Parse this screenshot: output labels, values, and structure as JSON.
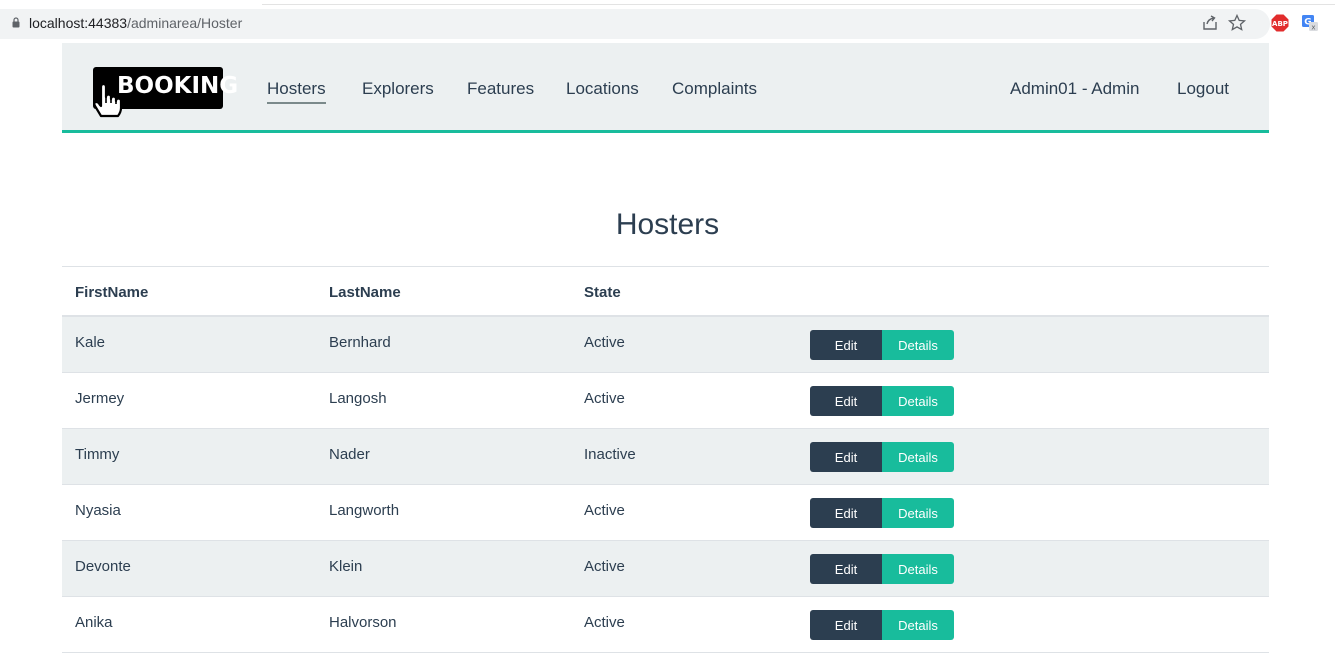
{
  "browser": {
    "url_host": "localhost:44383",
    "url_path": "/adminarea/Hoster",
    "icons": [
      "lock-icon",
      "share-icon",
      "star-icon",
      "adblock-icon",
      "translate-icon"
    ],
    "adblock_label": "ABP"
  },
  "navbar": {
    "brand": "BOOKING",
    "links": [
      "Hosters",
      "Explorers",
      "Features",
      "Locations",
      "Complaints"
    ],
    "active_link": "Hosters",
    "user_label": "Admin01 - Admin",
    "logout_label": "Logout",
    "accent_color": "#18bc9c"
  },
  "page": {
    "title": "Hosters"
  },
  "table": {
    "headers": [
      "FirstName",
      "LastName",
      "State"
    ],
    "edit_label": "Edit",
    "details_label": "Details",
    "rows": [
      {
        "first": "Kale",
        "last": "Bernhard",
        "state": "Active"
      },
      {
        "first": "Jermey",
        "last": "Langosh",
        "state": "Active"
      },
      {
        "first": "Timmy",
        "last": "Nader",
        "state": "Inactive"
      },
      {
        "first": "Nyasia",
        "last": "Langworth",
        "state": "Active"
      },
      {
        "first": "Devonte",
        "last": "Klein",
        "state": "Active"
      },
      {
        "first": "Anika",
        "last": "Halvorson",
        "state": "Active"
      }
    ]
  }
}
